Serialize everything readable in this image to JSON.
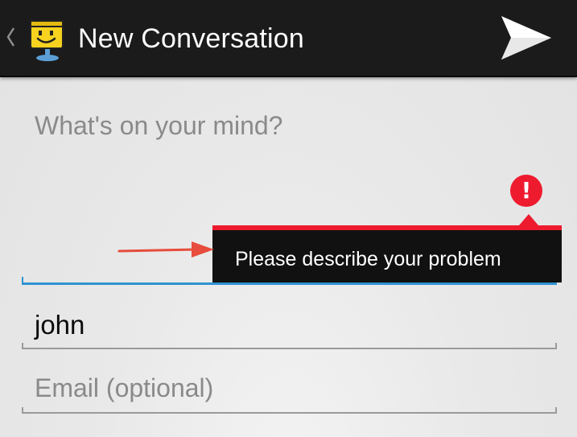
{
  "action_bar": {
    "title": "New Conversation",
    "up_icon": "chevron-left-icon",
    "app_icon": "smiley-mascot-icon",
    "send_icon": "send-icon",
    "background_color": "#1b1b1b"
  },
  "form": {
    "message": {
      "placeholder": "What's on your mind?",
      "value": "",
      "focused": true,
      "accent_color": "#2f93d1"
    },
    "name": {
      "value": "john"
    },
    "email": {
      "placeholder": "Email (optional)",
      "value": ""
    }
  },
  "error": {
    "icon": "error-exclamation-icon",
    "message": "Please describe your problem",
    "color": "#ee1b2e"
  },
  "annotation": {
    "icon": "arrow-right-icon",
    "color": "#e74c3c"
  }
}
